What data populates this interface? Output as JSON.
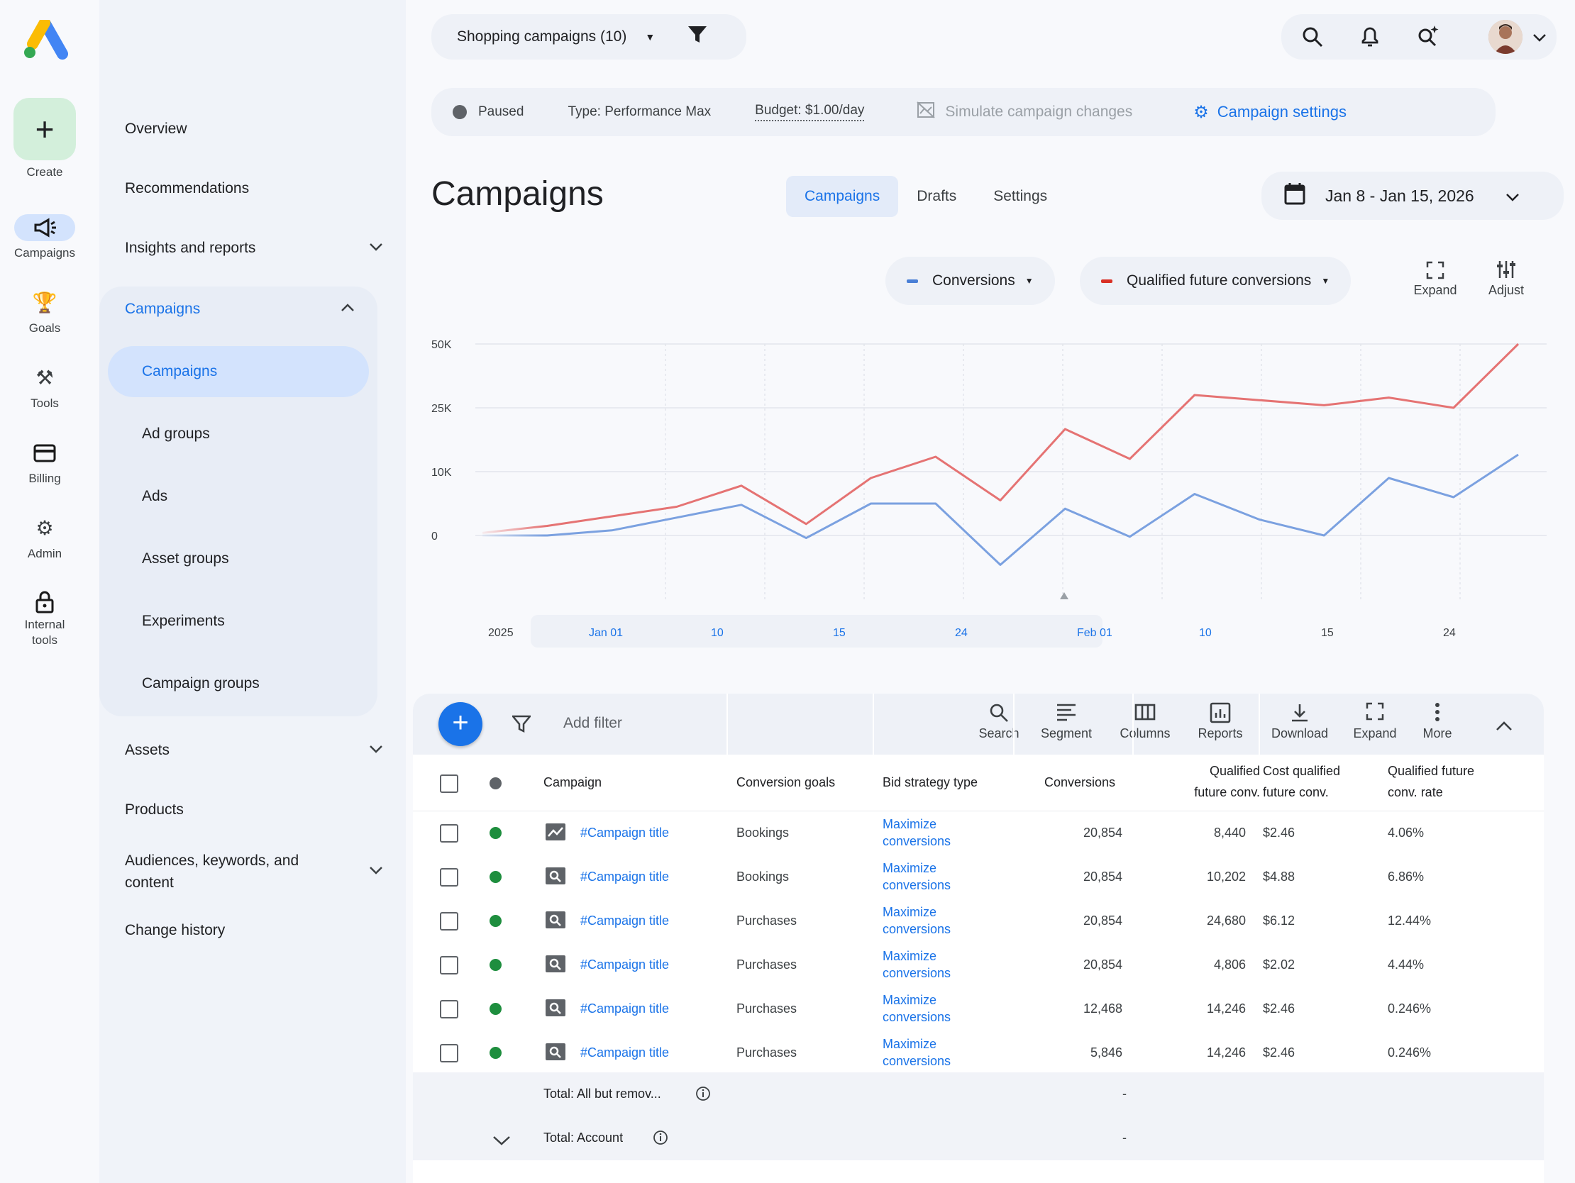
{
  "rail": {
    "create": "Create",
    "campaigns": "Campaigns",
    "goals": "Goals",
    "tools": "Tools",
    "billing": "Billing",
    "admin": "Admin",
    "internal_tools_1": "Internal",
    "internal_tools_2": "tools"
  },
  "nav": {
    "overview": "Overview",
    "recommendations": "Recommendations",
    "insights": "Insights and reports",
    "campaigns_group": "Campaigns",
    "campaigns": "Campaigns",
    "ad_groups": "Ad groups",
    "ads": "Ads",
    "asset_groups": "Asset groups",
    "experiments": "Experiments",
    "campaign_groups": "Campaign groups",
    "assets": "Assets",
    "products": "Products",
    "audiences_1": "Audiences, keywords, and",
    "audiences_2": "content",
    "change_history": "Change history"
  },
  "topbar": {
    "account": "Shopping campaigns (10)"
  },
  "status": {
    "paused": "Paused",
    "type": "Type: Performance Max",
    "budget": "Budget: $1.00/day",
    "simulate": "Simulate campaign changes",
    "settings": "Campaign settings"
  },
  "page_title": "Campaigns",
  "tabs": [
    "Campaigns",
    "Drafts",
    "Settings"
  ],
  "date_range": "Jan 8 - Jan 15, 2026",
  "metrics": {
    "m1": "Conversions",
    "m2": "Qualified future conversions",
    "expand": "Expand",
    "adjust": "Adjust"
  },
  "colors": {
    "blue_series": "#7ba1e0",
    "red_series": "#e57373",
    "accent": "#1a73e8"
  },
  "chart_data": {
    "type": "line",
    "y_ticks": [
      "50K",
      "25K",
      "10K",
      "0"
    ],
    "x_ticks": [
      "2025",
      "Jan 01",
      "10",
      "15",
      "24",
      "Feb 01",
      "10",
      "15",
      "24"
    ],
    "series": [
      {
        "name": "Conversions",
        "values": [
          0,
          0,
          800,
          2800,
          4800,
          -400,
          5000,
          5000,
          -4600,
          4200,
          -200,
          6500,
          2500,
          0,
          9000,
          6000,
          14000
        ]
      },
      {
        "name": "Qualified future conversions",
        "values": [
          400,
          1500,
          3000,
          4500,
          7800,
          1800,
          9000,
          13500,
          5500,
          20000,
          13000,
          30000,
          28000,
          26000,
          29000,
          25000,
          50000
        ]
      }
    ]
  },
  "toolbar": {
    "add_filter": "Add filter",
    "search": "Search",
    "segment": "Segment",
    "columns": "Columns",
    "reports": "Reports",
    "download": "Download",
    "expand": "Expand",
    "more": "More"
  },
  "table": {
    "headers": {
      "campaign": "Campaign",
      "conv_goals": "Conversion goals",
      "bid_strategy": "Bid strategy type",
      "conversions": "Conversions",
      "qfc_1": "Qualified",
      "qfc_2": "future conv.",
      "cost_1": "Cost qualified",
      "cost_2": "future conv.",
      "rate_1": "Qualified future",
      "rate_2": "conv. rate"
    },
    "rows": [
      {
        "title": "#Campaign title",
        "goal": "Bookings",
        "bid_1": "Maximize",
        "bid_2": "conversions",
        "conv": "20,854",
        "qfc": "8,440",
        "cost": "$2.46",
        "rate": "4.06%"
      },
      {
        "title": "#Campaign title",
        "goal": "Bookings",
        "bid_1": "Maximize",
        "bid_2": "conversions",
        "conv": "20,854",
        "qfc": "10,202",
        "cost": "$4.88",
        "rate": "6.86%"
      },
      {
        "title": "#Campaign title",
        "goal": "Purchases",
        "bid_1": "Maximize",
        "bid_2": "conversions",
        "conv": "20,854",
        "qfc": "24,680",
        "cost": "$6.12",
        "rate": "12.44%"
      },
      {
        "title": "#Campaign title",
        "goal": "Purchases",
        "bid_1": "Maximize",
        "bid_2": "conversions",
        "conv": "20,854",
        "qfc": "4,806",
        "cost": "$2.02",
        "rate": "4.44%"
      },
      {
        "title": "#Campaign title",
        "goal": "Purchases",
        "bid_1": "Maximize",
        "bid_2": "conversions",
        "conv": "12,468",
        "qfc": "14,246",
        "cost": "$2.46",
        "rate": "0.246%"
      },
      {
        "title": "#Campaign title",
        "goal": "Purchases",
        "bid_1": "Maximize",
        "bid_2": "conversions",
        "conv": "5,846",
        "qfc": "14,246",
        "cost": "$2.46",
        "rate": "0.246%"
      }
    ],
    "total_1": "Total: All but remov...",
    "total_2": "Total: Account",
    "total_dash": "-"
  }
}
